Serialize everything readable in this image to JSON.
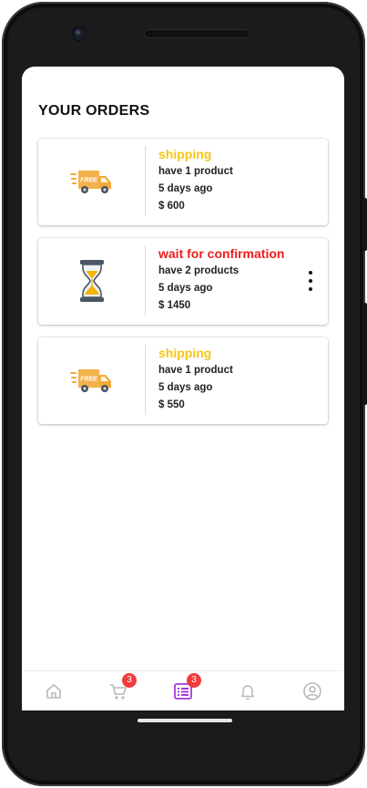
{
  "page": {
    "title": "YOUR ORDERS"
  },
  "orders": [
    {
      "status": "shipping",
      "products": "have 1 product",
      "time": "5 days ago",
      "price": "$ 600",
      "icon": "delivery-truck-icon",
      "status_color": "#f5c518",
      "truck_label": "FREE"
    },
    {
      "status": "wait for confirmation",
      "products": "have 2 products",
      "time": "5 days ago",
      "price": "$ 1450",
      "icon": "hourglass-icon",
      "status_color": "#ef1c1c"
    },
    {
      "status": "shipping",
      "products": "have 1 product",
      "time": "5 days ago",
      "price": "$ 550",
      "icon": "delivery-truck-icon",
      "status_color": "#f5c518",
      "truck_label": "FREE"
    }
  ],
  "bottom_nav": {
    "items": [
      {
        "icon": "home-icon",
        "active": false
      },
      {
        "icon": "cart-icon",
        "badge": "3",
        "active": false
      },
      {
        "icon": "orders-list-icon",
        "badge": "3",
        "active": true
      },
      {
        "icon": "bell-icon",
        "active": false
      },
      {
        "icon": "profile-icon",
        "active": false
      }
    ],
    "active_color": "#a23ad6",
    "inactive_color": "#b9b9b9"
  }
}
